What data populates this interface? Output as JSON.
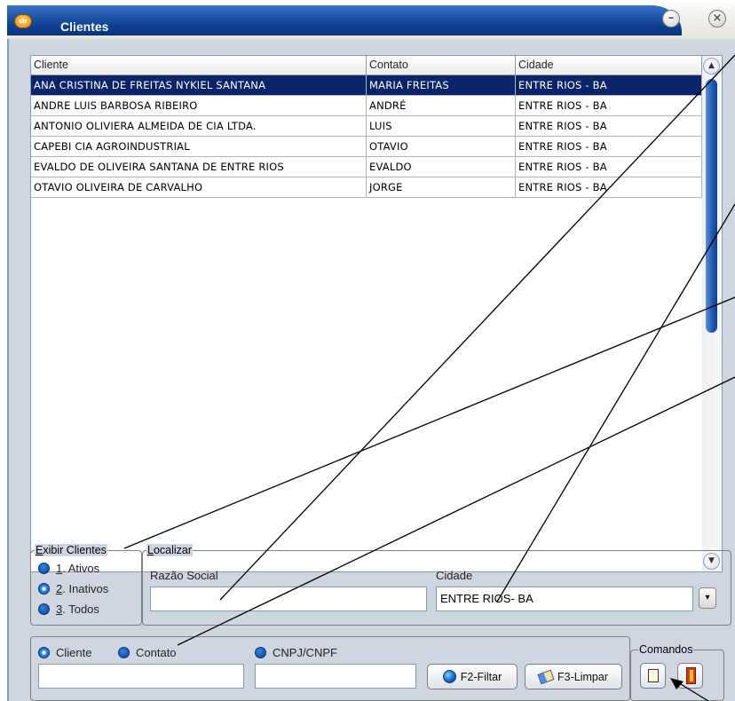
{
  "window": {
    "title": "Clientes",
    "app_icon_text": "sir",
    "minimize_glyph": "–",
    "close_glyph": "×"
  },
  "grid": {
    "columns": [
      "Cliente",
      "Contato",
      "Cidade"
    ],
    "rows": [
      [
        "ANA CRISTINA DE FREITAS NYKIEL SANTANA",
        "MARIA FREITAS",
        "ENTRE RIOS - BA"
      ],
      [
        "ANDRE LUIS BARBOSA RIBEIRO",
        "ANDRÉ",
        "ENTRE RIOS - BA"
      ],
      [
        "ANTONIO OLIVIERA ALMEIDA DE CIA LTDA.",
        "LUIS",
        "ENTRE RIOS - BA"
      ],
      [
        "CAPEBI CIA AGROINDUSTRIAL",
        "OTAVIO",
        "ENTRE RIOS - BA"
      ],
      [
        "EVALDO DE OLIVEIRA SANTANA DE ENTRE RIOS",
        "EVALDO",
        "ENTRE RIOS - BA"
      ],
      [
        "OTAVIO OLIVEIRA DE CARVALHO",
        "JORGE",
        "ENTRE RIOS - BA"
      ]
    ],
    "selected_row": 0,
    "scroll_up_glyph": "▲",
    "scroll_down_glyph": "▼"
  },
  "exibir": {
    "legend_first": "E",
    "legend_rest": "xibir Clientes",
    "options": [
      {
        "key": "1",
        "label": ". Ativos",
        "selected": false
      },
      {
        "key": "2",
        "label": ". Inativos",
        "selected": true
      },
      {
        "key": "3",
        "label": ". Todos",
        "selected": false
      }
    ]
  },
  "localizar": {
    "legend_first": "L",
    "legend_rest": "ocalizar",
    "razao_label": "Razão Social",
    "razao_value": "",
    "cidade_label": "Cidade",
    "cidade_value": "ENTRE RIOS- BA",
    "dropdown_glyph": "▾"
  },
  "search": {
    "options": [
      "Cliente",
      "Contato",
      "CNPJ/CNPF"
    ],
    "selected": 0,
    "field1_value": "",
    "field2_value": "",
    "filter_label": "F2-Filtar",
    "clear_label": "F3-Limpar"
  },
  "comandos": {
    "legend": "Comandos"
  }
}
